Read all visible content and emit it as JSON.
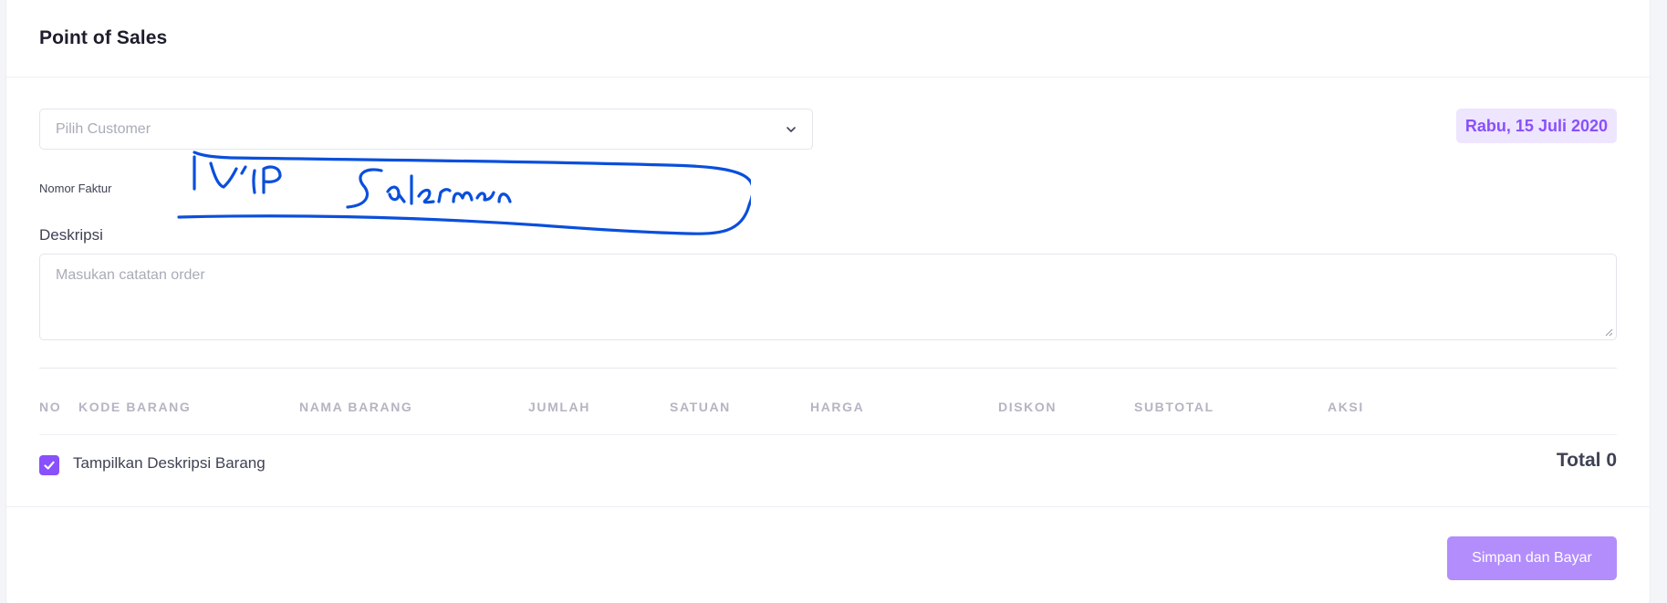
{
  "header": {
    "title": "Point of Sales"
  },
  "customer_select": {
    "placeholder": "Pilih Customer"
  },
  "date_badge": "Rabu, 15 Juli 2020",
  "nomor_faktur": {
    "label": "Nomor Faktur"
  },
  "deskripsi": {
    "label": "Deskripsi",
    "placeholder": "Masukan catatan order"
  },
  "table": {
    "columns": [
      {
        "key": "no",
        "label": "NO"
      },
      {
        "key": "kode",
        "label": "KODE BARANG"
      },
      {
        "key": "nama",
        "label": "NAMA BARANG"
      },
      {
        "key": "jumlah",
        "label": "JUMLAH"
      },
      {
        "key": "satuan",
        "label": "SATUAN"
      },
      {
        "key": "harga",
        "label": "HARGA"
      },
      {
        "key": "diskon",
        "label": "DISKON"
      },
      {
        "key": "subtotal",
        "label": "SUBTOTAL"
      },
      {
        "key": "aksi",
        "label": "AKSI"
      }
    ],
    "rows": []
  },
  "show_description": {
    "label": "Tampilkan Deskripsi Barang",
    "checked": true
  },
  "total": "Total 0",
  "submit_button": "Simpan dan Bayar",
  "colors": {
    "accent": "#8950fc",
    "accent_light": "#eee5ff",
    "button_disabled": "#b38dfc",
    "scribble": "#0a4fdc"
  },
  "icons": {
    "select_arrow": "chevron-down-icon",
    "checkbox": "check-icon",
    "annotation": "handwritten-redaction-scribble"
  }
}
